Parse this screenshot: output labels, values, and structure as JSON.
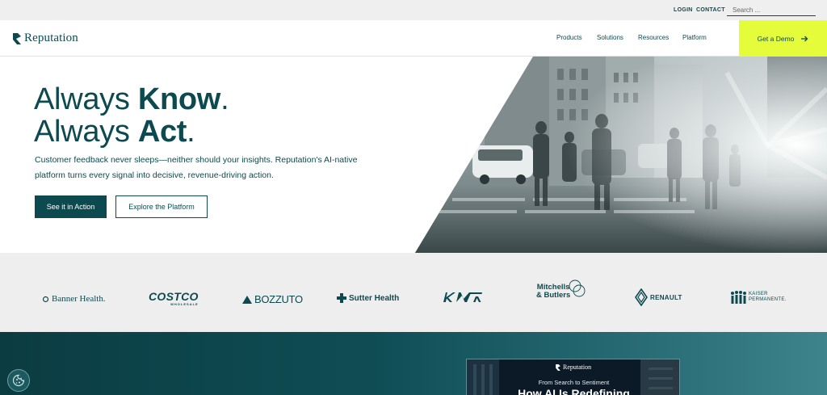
{
  "utility": {
    "login": "LOGIN",
    "contact": "CONTACT",
    "search_placeholder": "Search ..."
  },
  "header": {
    "logo_text": "Reputation",
    "nav": [
      "Products",
      "Solutions",
      "Resources",
      "Platform"
    ],
    "demo_label": "Get a Demo"
  },
  "hero": {
    "title_line1_regular": "Always ",
    "title_line1_bold": "Know",
    "title_line1_end": ".",
    "title_line2_regular": "Always ",
    "title_line2_bold": "Act",
    "title_line2_end": ".",
    "subtitle_line1": "Customer feedback never sleeps—neither should your insights. Reputation's AI-native",
    "subtitle_line2": "platform turns every signal into decisive, revenue-driving action.",
    "primary_cta": "See it in Action",
    "secondary_cta": "Explore the Platform"
  },
  "clients": {
    "banner_health": "Banner Health.",
    "costco": "COSTCO",
    "costco_sub": "WHOLESALE",
    "bozzuto": "BOZZUTO",
    "sutter_health": "Sutter Health",
    "kia": "KIA",
    "mitchells_line1": "Mitchells",
    "mitchells_line2": "& Butlers",
    "renault": "RENAULT",
    "kaiser_line1": "KAISER",
    "kaiser_line2": "PERMANENTE."
  },
  "feature_card": {
    "logo_text": "Reputation",
    "subtitle": "From Search to Sentiment",
    "title": "How AI Is Redefining"
  },
  "colors": {
    "brand_teal": "#0d4a50",
    "accent_lime": "#e4fc3a",
    "band_gray": "#eeeeee"
  },
  "icons": {
    "demo_arrow": "arrow-right-icon",
    "cookie": "cookie-icon",
    "logo": "reputation-logo-mark"
  }
}
